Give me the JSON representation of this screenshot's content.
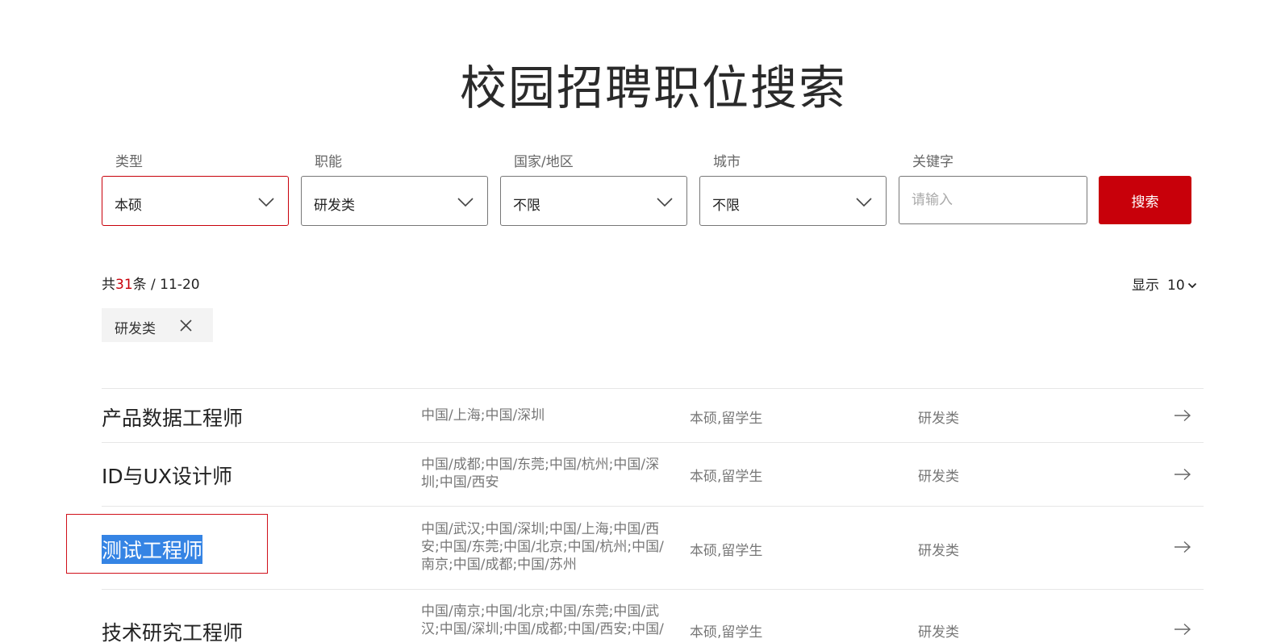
{
  "page": {
    "title": "校园招聘职位搜索"
  },
  "filters": {
    "type": {
      "label": "类型",
      "value": "本硕"
    },
    "function": {
      "label": "职能",
      "value": "研发类"
    },
    "region": {
      "label": "国家/地区",
      "value": "不限"
    },
    "city": {
      "label": "城市",
      "value": "不限"
    },
    "keyword": {
      "label": "关键字",
      "placeholder": "请输入",
      "value": ""
    },
    "search_label": "搜索"
  },
  "summary": {
    "prefix": "共",
    "count": "31",
    "suffix": "条 / 11-20",
    "page_size_label": "显示",
    "page_size_value": "10"
  },
  "active_tags": [
    {
      "label": "研发类"
    }
  ],
  "jobs": [
    {
      "title": "产品数据工程师",
      "locations": "中国/上海;中国/深圳",
      "degree": "本硕,留学生",
      "category": "研发类"
    },
    {
      "title": "ID与UX设计师",
      "locations": "中国/成都;中国/东莞;中国/杭州;中国/深圳;中国/西安",
      "degree": "本硕,留学生",
      "category": "研发类"
    },
    {
      "title": "测试工程师",
      "locations": "中国/武汉;中国/深圳;中国/上海;中国/西安;中国/东莞;中国/北京;中国/杭州;中国/南京;中国/成都;中国/苏州",
      "degree": "本硕,留学生",
      "category": "研发类"
    },
    {
      "title": "技术研究工程师",
      "locations": "中国/南京;中国/北京;中国/东莞;中国/武汉;中国/深圳;中国/成都;中国/西安;中国/",
      "degree": "本硕,留学生",
      "category": "研发类"
    }
  ],
  "colors": {
    "accent": "#c8000a",
    "selection": "#3584e4"
  }
}
